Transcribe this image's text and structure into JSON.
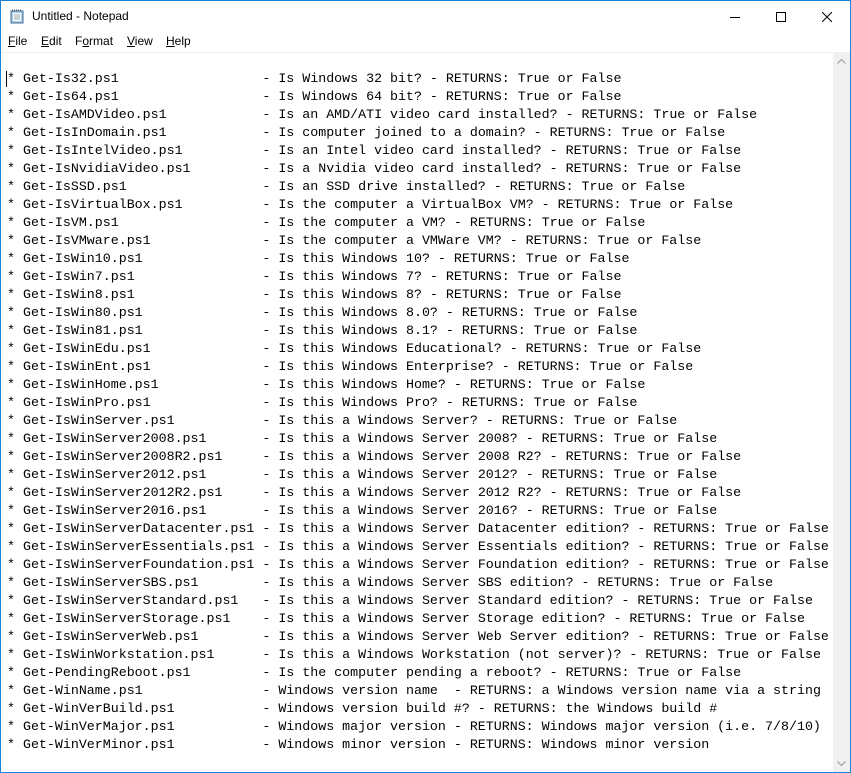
{
  "window": {
    "title": "Untitled - Notepad",
    "controls": {
      "minimize": "minimize",
      "maximize": "maximize",
      "close": "close"
    }
  },
  "menu": [
    {
      "pre": "",
      "u": "F",
      "post": "ile"
    },
    {
      "pre": "",
      "u": "E",
      "post": "dit"
    },
    {
      "pre": "F",
      "u": "o",
      "post": "rmat"
    },
    {
      "pre": "",
      "u": "V",
      "post": "iew"
    },
    {
      "pre": "",
      "u": "H",
      "post": "elp"
    }
  ],
  "editor": {
    "lines": [
      {
        "name": "Get-Is32.ps1",
        "desc": "Is Windows 32 bit? - RETURNS: True or False"
      },
      {
        "name": "Get-Is64.ps1",
        "desc": "Is Windows 64 bit? - RETURNS: True or False"
      },
      {
        "name": "Get-IsAMDVideo.ps1",
        "desc": "Is an AMD/ATI video card installed? - RETURNS: True or False"
      },
      {
        "name": "Get-IsInDomain.ps1",
        "desc": "Is computer joined to a domain? - RETURNS: True or False"
      },
      {
        "name": "Get-IsIntelVideo.ps1",
        "desc": "Is an Intel video card installed? - RETURNS: True or False"
      },
      {
        "name": "Get-IsNvidiaVideo.ps1",
        "desc": "Is a Nvidia video card installed? - RETURNS: True or False"
      },
      {
        "name": "Get-IsSSD.ps1",
        "desc": "Is an SSD drive installed? - RETURNS: True or False"
      },
      {
        "name": "Get-IsVirtualBox.ps1",
        "desc": "Is the computer a VirtualBox VM? - RETURNS: True or False"
      },
      {
        "name": "Get-IsVM.ps1",
        "desc": "Is the computer a VM? - RETURNS: True or False"
      },
      {
        "name": "Get-IsVMware.ps1",
        "desc": "Is the computer a VMWare VM? - RETURNS: True or False"
      },
      {
        "name": "Get-IsWin10.ps1",
        "desc": "Is this Windows 10? - RETURNS: True or False"
      },
      {
        "name": "Get-IsWin7.ps1",
        "desc": "Is this Windows 7? - RETURNS: True or False"
      },
      {
        "name": "Get-IsWin8.ps1",
        "desc": "Is this Windows 8? - RETURNS: True or False"
      },
      {
        "name": "Get-IsWin80.ps1",
        "desc": "Is this Windows 8.0? - RETURNS: True or False"
      },
      {
        "name": "Get-IsWin81.ps1",
        "desc": "Is this Windows 8.1? - RETURNS: True or False"
      },
      {
        "name": "Get-IsWinEdu.ps1",
        "desc": "Is this Windows Educational? - RETURNS: True or False"
      },
      {
        "name": "Get-IsWinEnt.ps1",
        "desc": "Is this Windows Enterprise? - RETURNS: True or False"
      },
      {
        "name": "Get-IsWinHome.ps1",
        "desc": "Is this Windows Home? - RETURNS: True or False"
      },
      {
        "name": "Get-IsWinPro.ps1",
        "desc": "Is this Windows Pro? - RETURNS: True or False"
      },
      {
        "name": "Get-IsWinServer.ps1",
        "desc": "Is this a Windows Server? - RETURNS: True or False"
      },
      {
        "name": "Get-IsWinServer2008.ps1",
        "desc": "Is this a Windows Server 2008? - RETURNS: True or False"
      },
      {
        "name": "Get-IsWinServer2008R2.ps1",
        "desc": "Is this a Windows Server 2008 R2? - RETURNS: True or False"
      },
      {
        "name": "Get-IsWinServer2012.ps1",
        "desc": "Is this a Windows Server 2012? - RETURNS: True or False"
      },
      {
        "name": "Get-IsWinServer2012R2.ps1",
        "desc": "Is this a Windows Server 2012 R2? - RETURNS: True or False"
      },
      {
        "name": "Get-IsWinServer2016.ps1",
        "desc": "Is this a Windows Server 2016? - RETURNS: True or False"
      },
      {
        "name": "Get-IsWinServerDatacenter.ps1",
        "desc": "Is this a Windows Server Datacenter edition? - RETURNS: True or False"
      },
      {
        "name": "Get-IsWinServerEssentials.ps1",
        "desc": "Is this a Windows Server Essentials edition? - RETURNS: True or False"
      },
      {
        "name": "Get-IsWinServerFoundation.ps1",
        "desc": "Is this a Windows Server Foundation edition? - RETURNS: True or False"
      },
      {
        "name": "Get-IsWinServerSBS.ps1",
        "desc": "Is this a Windows Server SBS edition? - RETURNS: True or False"
      },
      {
        "name": "Get-IsWinServerStandard.ps1",
        "desc": "Is this a Windows Server Standard edition? - RETURNS: True or False"
      },
      {
        "name": "Get-IsWinServerStorage.ps1",
        "desc": "Is this a Windows Server Storage edition? - RETURNS: True or False"
      },
      {
        "name": "Get-IsWinServerWeb.ps1",
        "desc": "Is this a Windows Server Web Server edition? - RETURNS: True or False"
      },
      {
        "name": "Get-IsWinWorkstation.ps1",
        "desc": "Is this a Windows Workstation (not server)? - RETURNS: True or False"
      },
      {
        "name": "Get-PendingReboot.ps1",
        "desc": "Is the computer pending a reboot? - RETURNS: True or False"
      },
      {
        "name": "Get-WinName.ps1",
        "desc": "Windows version name  - RETURNS: a Windows version name via a string"
      },
      {
        "name": "Get-WinVerBuild.ps1",
        "desc": "Windows version build #? - RETURNS: the Windows build #"
      },
      {
        "name": "Get-WinVerMajor.ps1",
        "desc": "Windows major version - RETURNS: Windows major version (i.e. 7/8/10)"
      },
      {
        "name": "Get-WinVerMinor.ps1",
        "desc": "Windows minor version - RETURNS: Windows minor version"
      }
    ]
  },
  "colors": {
    "window_border": "#1883d7",
    "scrollbar_track": "#f0f0f0",
    "arrow": "#a0a0a0"
  }
}
